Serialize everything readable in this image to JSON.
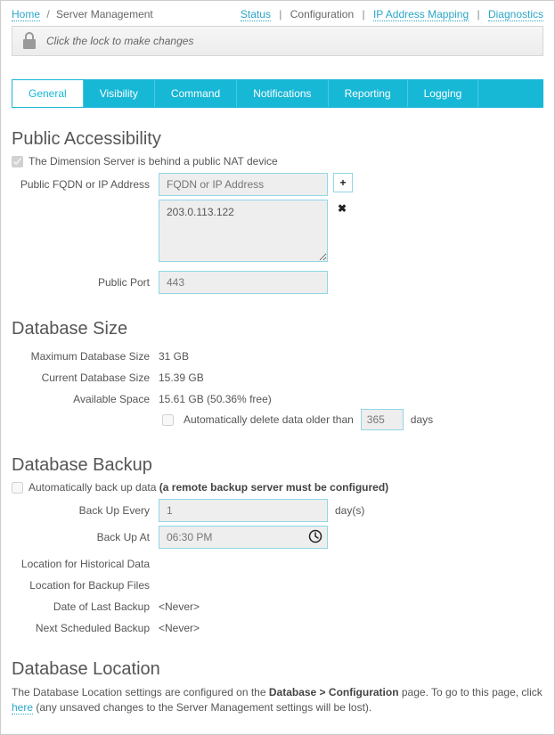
{
  "breadcrumb": {
    "home": "Home",
    "current": "Server Management"
  },
  "topnav": {
    "status": "Status",
    "config": "Configuration",
    "ipmap": "IP Address Mapping",
    "diag": "Diagnostics"
  },
  "lockbar": {
    "text": "Click the lock to make changes"
  },
  "tabs": [
    "General",
    "Visibility",
    "Command",
    "Notifications",
    "Reporting",
    "Logging"
  ],
  "public_access": {
    "heading": "Public Accessibility",
    "nat_checkbox_label": "The Dimension Server is behind a public NAT device",
    "nat_checked": true,
    "fqdn_label": "Public FQDN or IP Address",
    "fqdn_placeholder": "FQDN or IP Address",
    "fqdn_list_value": "203.0.113.122",
    "port_label": "Public Port",
    "port_value": "443"
  },
  "db_size": {
    "heading": "Database Size",
    "max_label": "Maximum Database Size",
    "max_value": "31 GB",
    "cur_label": "Current Database Size",
    "cur_value": "15.39 GB",
    "avail_label": "Available Space",
    "avail_value": "15.61 GB (50.36% free)",
    "auto_delete_label": "Automatically delete data older than",
    "auto_delete_value": "365",
    "auto_delete_unit": "days"
  },
  "db_backup": {
    "heading": "Database Backup",
    "auto_label": "Automatically back up data",
    "auto_hint": "(a remote backup server must be configured)",
    "every_label": "Back Up Every",
    "every_value": "1",
    "every_unit": "day(s)",
    "at_label": "Back Up At",
    "at_value": "06:30 PM",
    "loc_hist_label": "Location for Historical Data",
    "loc_hist_value": "",
    "loc_files_label": "Location for Backup Files",
    "loc_files_value": "",
    "last_label": "Date of Last Backup",
    "last_value": "<Never>",
    "next_label": "Next Scheduled Backup",
    "next_value": "<Never>"
  },
  "db_location": {
    "heading": "Database Location",
    "text_pre": "The Database Location settings are configured on the ",
    "text_bold": "Database > Configuration",
    "text_mid": " page. To go to this page, click ",
    "link": "here",
    "text_post": " (any unsaved changes to the Server Management settings will be lost)."
  }
}
